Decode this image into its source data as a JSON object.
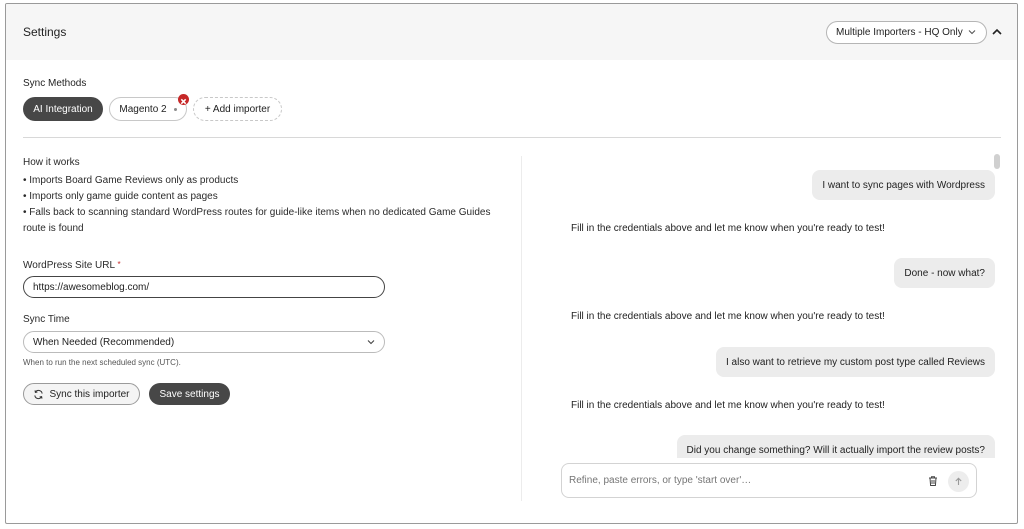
{
  "header": {
    "title": "Settings",
    "importer_select": "Multiple Importers - HQ Only"
  },
  "sync_methods": {
    "label": "Sync Methods",
    "chips": [
      "AI Integration",
      "Magento 2"
    ],
    "add_label": "+ Add importer"
  },
  "how_it_works": {
    "title": "How it works",
    "lines": [
      "• Imports Board Game Reviews only as products",
      "• Imports only game guide content as pages",
      "• Falls back to scanning standard WordPress routes for guide-like items when no dedicated Game Guides",
      "route is found"
    ]
  },
  "url_field": {
    "label": "WordPress Site URL",
    "required_mark": "*",
    "value": "https://awesomeblog.com/"
  },
  "sync_time": {
    "label": "Sync Time",
    "value": "When Needed (Recommended)",
    "help": "When to run the next scheduled sync (UTC)."
  },
  "actions": {
    "sync_label": "Sync this importer",
    "save_label": "Save settings"
  },
  "chat": {
    "messages": [
      {
        "role": "user",
        "text": "I want to sync pages with Wordpress"
      },
      {
        "role": "assistant",
        "text": "Fill in the credentials above and let me know when you're ready to test!"
      },
      {
        "role": "user",
        "text": "Done - now what?"
      },
      {
        "role": "assistant",
        "text": "Fill in the credentials above and let me know when you're ready to test!"
      },
      {
        "role": "user",
        "text": "I also want to retrieve my custom post type called Reviews"
      },
      {
        "role": "assistant",
        "text": "Fill in the credentials above and let me know when you're ready to test!"
      },
      {
        "role": "user",
        "text": "Did you change something? Will it actually import the review posts?"
      }
    ],
    "composer_placeholder": "Refine, paste errors, or type 'start over'…"
  },
  "colors": {
    "accent_dark": "#474747",
    "remove_badge": "#c62828"
  }
}
